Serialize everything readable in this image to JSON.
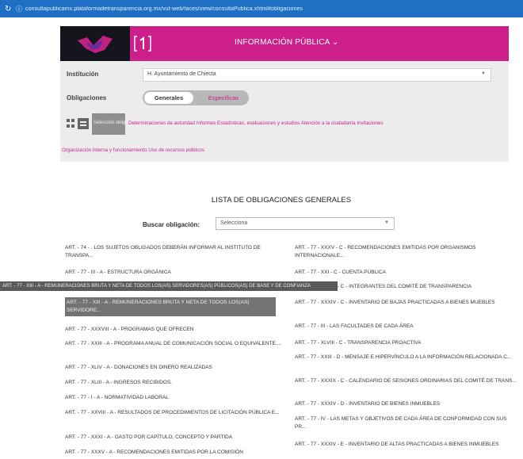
{
  "browser": {
    "url": "consultapublicamx.plataformadetransparencia.org.mx/vut-web/faces/view/consultaPublica.xhtml#obligaciones"
  },
  "header": {
    "title": "INFORMACIÓN PÚBLICA ⌄"
  },
  "filters": {
    "institucion_label": "Institución",
    "institucion_value": "H. Ayuntamiento de Chiecta",
    "obligaciones_label": "Obligaciones",
    "tab_generales": "Generales",
    "tab_especificas": "Específicas",
    "selected_button": "Selección obligaciones",
    "categories": "Determinaciones de autoridad  Informes  Estadísticas, evaluaciones y estudios  Atención a la ciudadanía  Invitaciones",
    "org_link": "Organización interna y funcionamiento  Uso de recursos públicos"
  },
  "list": {
    "title": "LISTA DE OBLIGACIONES GENERALES",
    "search_label": "Buscar obligación:",
    "search_value": "Selecciona",
    "tooltip": "ART. - 77 - XIII - A - REMUNERACIONES BRUTA Y NETA DE TODOS LOS(AS) SERVIDORES(AS) PÚBLICOS(AS) DE BASE Y DE CONFIANZA",
    "left_items": [
      "ART. - 74 - . LOS SUJETOS OBLIGADOS DEBERÁN INFORMAR AL INSTITUTO DE TRANSPA...",
      "ART. - 77 - III - A - ESTRUCTURA ORGÁNICA",
      "ART. - 77 - XIII - A - REMUNERACIONES BRUTA Y NETA DE TODOS LOS(AS) SERVIDORE...",
      "ART. - 77 - XXXVIII - A - PROGRAMAS QUE OFRECEN",
      "ART. - 77 - XXIII - A - PROGRAMA ANUAL DE COMUNICACIÓN SOCIAL O EQUIVALENTE....",
      "ART. - 77 - XLIV - A - DONACIONES EN DINERO REALIZADAS",
      "ART. - 77 - XLIII - A - INGRESOS RECIBIDOS.",
      "ART. - 77 - I - A - NORMATIVIDAD LABORAL",
      "ART. - 77 - XXVIII - A - RESULTADOS DE PROCEDIMIENTOS DE LICITACIÓN PÚBLICA E...",
      "ART. - 77 - XXXI - A - GASTO POR CAPÍTULO, CONCEPTO Y PARTIDA",
      "ART. - 77 - XXXV - A - RECOMENDACIONES EMITIDAS POR LA COMISIÓN"
    ],
    "right_items": [
      "ART. - 77 - XXXV - C - RECOMENDACIONES EMITIDAS POR ORGANISMOS INTERNACIONALE...",
      "ART. - 77 - XXI - C - CUENTA PÚBLICA",
      "ART. - 77 - XXXIX - C - INTEGRANTES DEL COMITÉ DE TRANSPARENCIA",
      "ART. - 77 - XXXIV - C - INVENTARIO DE BAJAS PRACTICADAS A BIENES MUEBLES",
      "ART. - 77 - III - LAS FACULTADES DE CADA ÁREA",
      "ART. - 77 - XLVIII - C - TRANSPARENCIA PROACTIVA",
      "ART. - 77 - XXIII - D - MENSAJE E HIPERVÍNCULO A LA INFORMACIÓN RELACIONADA C...",
      "ART. - 77 - XXXIX - C - CALENDARIO DE SESIONES ORDINARIAS DEL COMITÉ DE TRANS...",
      "ART. - 77 - XXXIV - D - INVENTARIO DE BIENES INMUEBLES",
      "ART. - 77 - IV - LAS METAS Y OBJETIVOS DE CADA ÁREA DE CONFORMIDAD CON SUS PR...",
      "ART. - 77 - XXXIV - E - INVENTARIO DE ALTAS PRACTICADAS A BIENES INMUEBLES"
    ]
  },
  "colors": {
    "brand": "#cc1f8a",
    "browser_bar": "#1f6fc4",
    "panel": "#ececec",
    "highlight": "#737373"
  }
}
